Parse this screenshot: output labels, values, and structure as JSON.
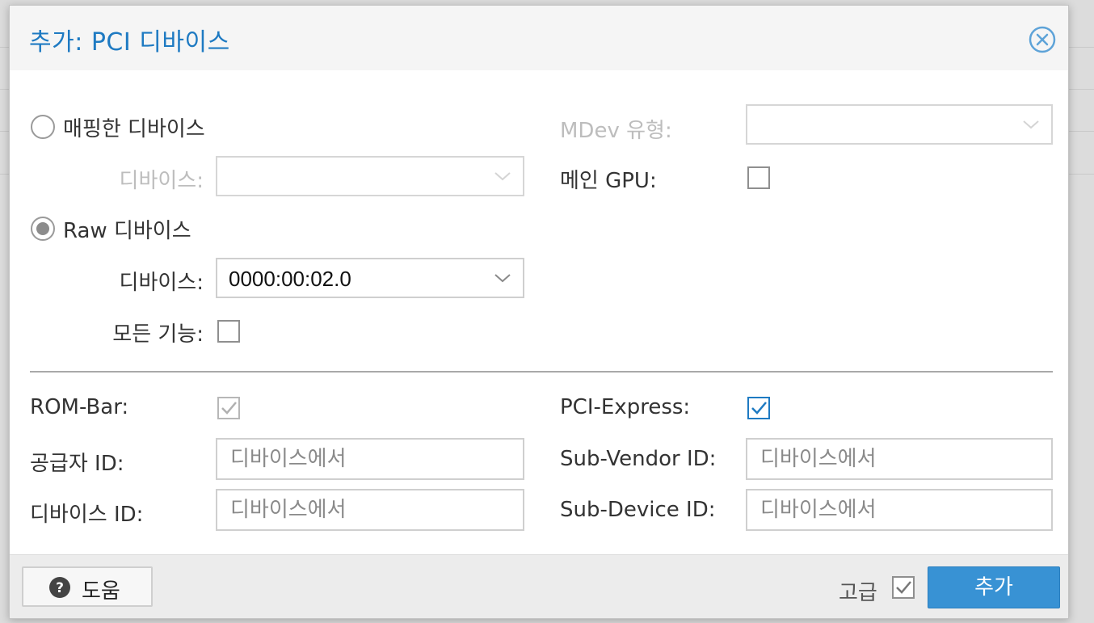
{
  "dialog": {
    "title": "추가: PCI 디바이스"
  },
  "left": {
    "mapped_radio_label": "매핑한 디바이스",
    "mapped_device_label": "디바이스:",
    "raw_radio_label": "Raw 디바이스",
    "raw_device_label": "디바이스:",
    "raw_device_value": "0000:00:02.0",
    "all_functions_label": "모든 기능:"
  },
  "right": {
    "mdev_type_label": "MDev 유형:",
    "primary_gpu_label": "메인 GPU:"
  },
  "advanced": {
    "rombar_label": "ROM-Bar:",
    "pcie_label": "PCI-Express:",
    "vendor_id_label": "공급자 ID:",
    "vendor_id_placeholder": "디바이스에서",
    "device_id_label": "디바이스 ID:",
    "device_id_placeholder": "디바이스에서",
    "sub_vendor_id_label": "Sub-Vendor ID:",
    "sub_vendor_id_placeholder": "디바이스에서",
    "sub_device_id_label": "Sub-Device ID:",
    "sub_device_id_placeholder": "디바이스에서"
  },
  "footer": {
    "help_label": "도움",
    "advanced_label": "고급",
    "add_label": "추가"
  },
  "colors": {
    "accent": "#1e7ac2",
    "primary_button": "#3892d4"
  }
}
